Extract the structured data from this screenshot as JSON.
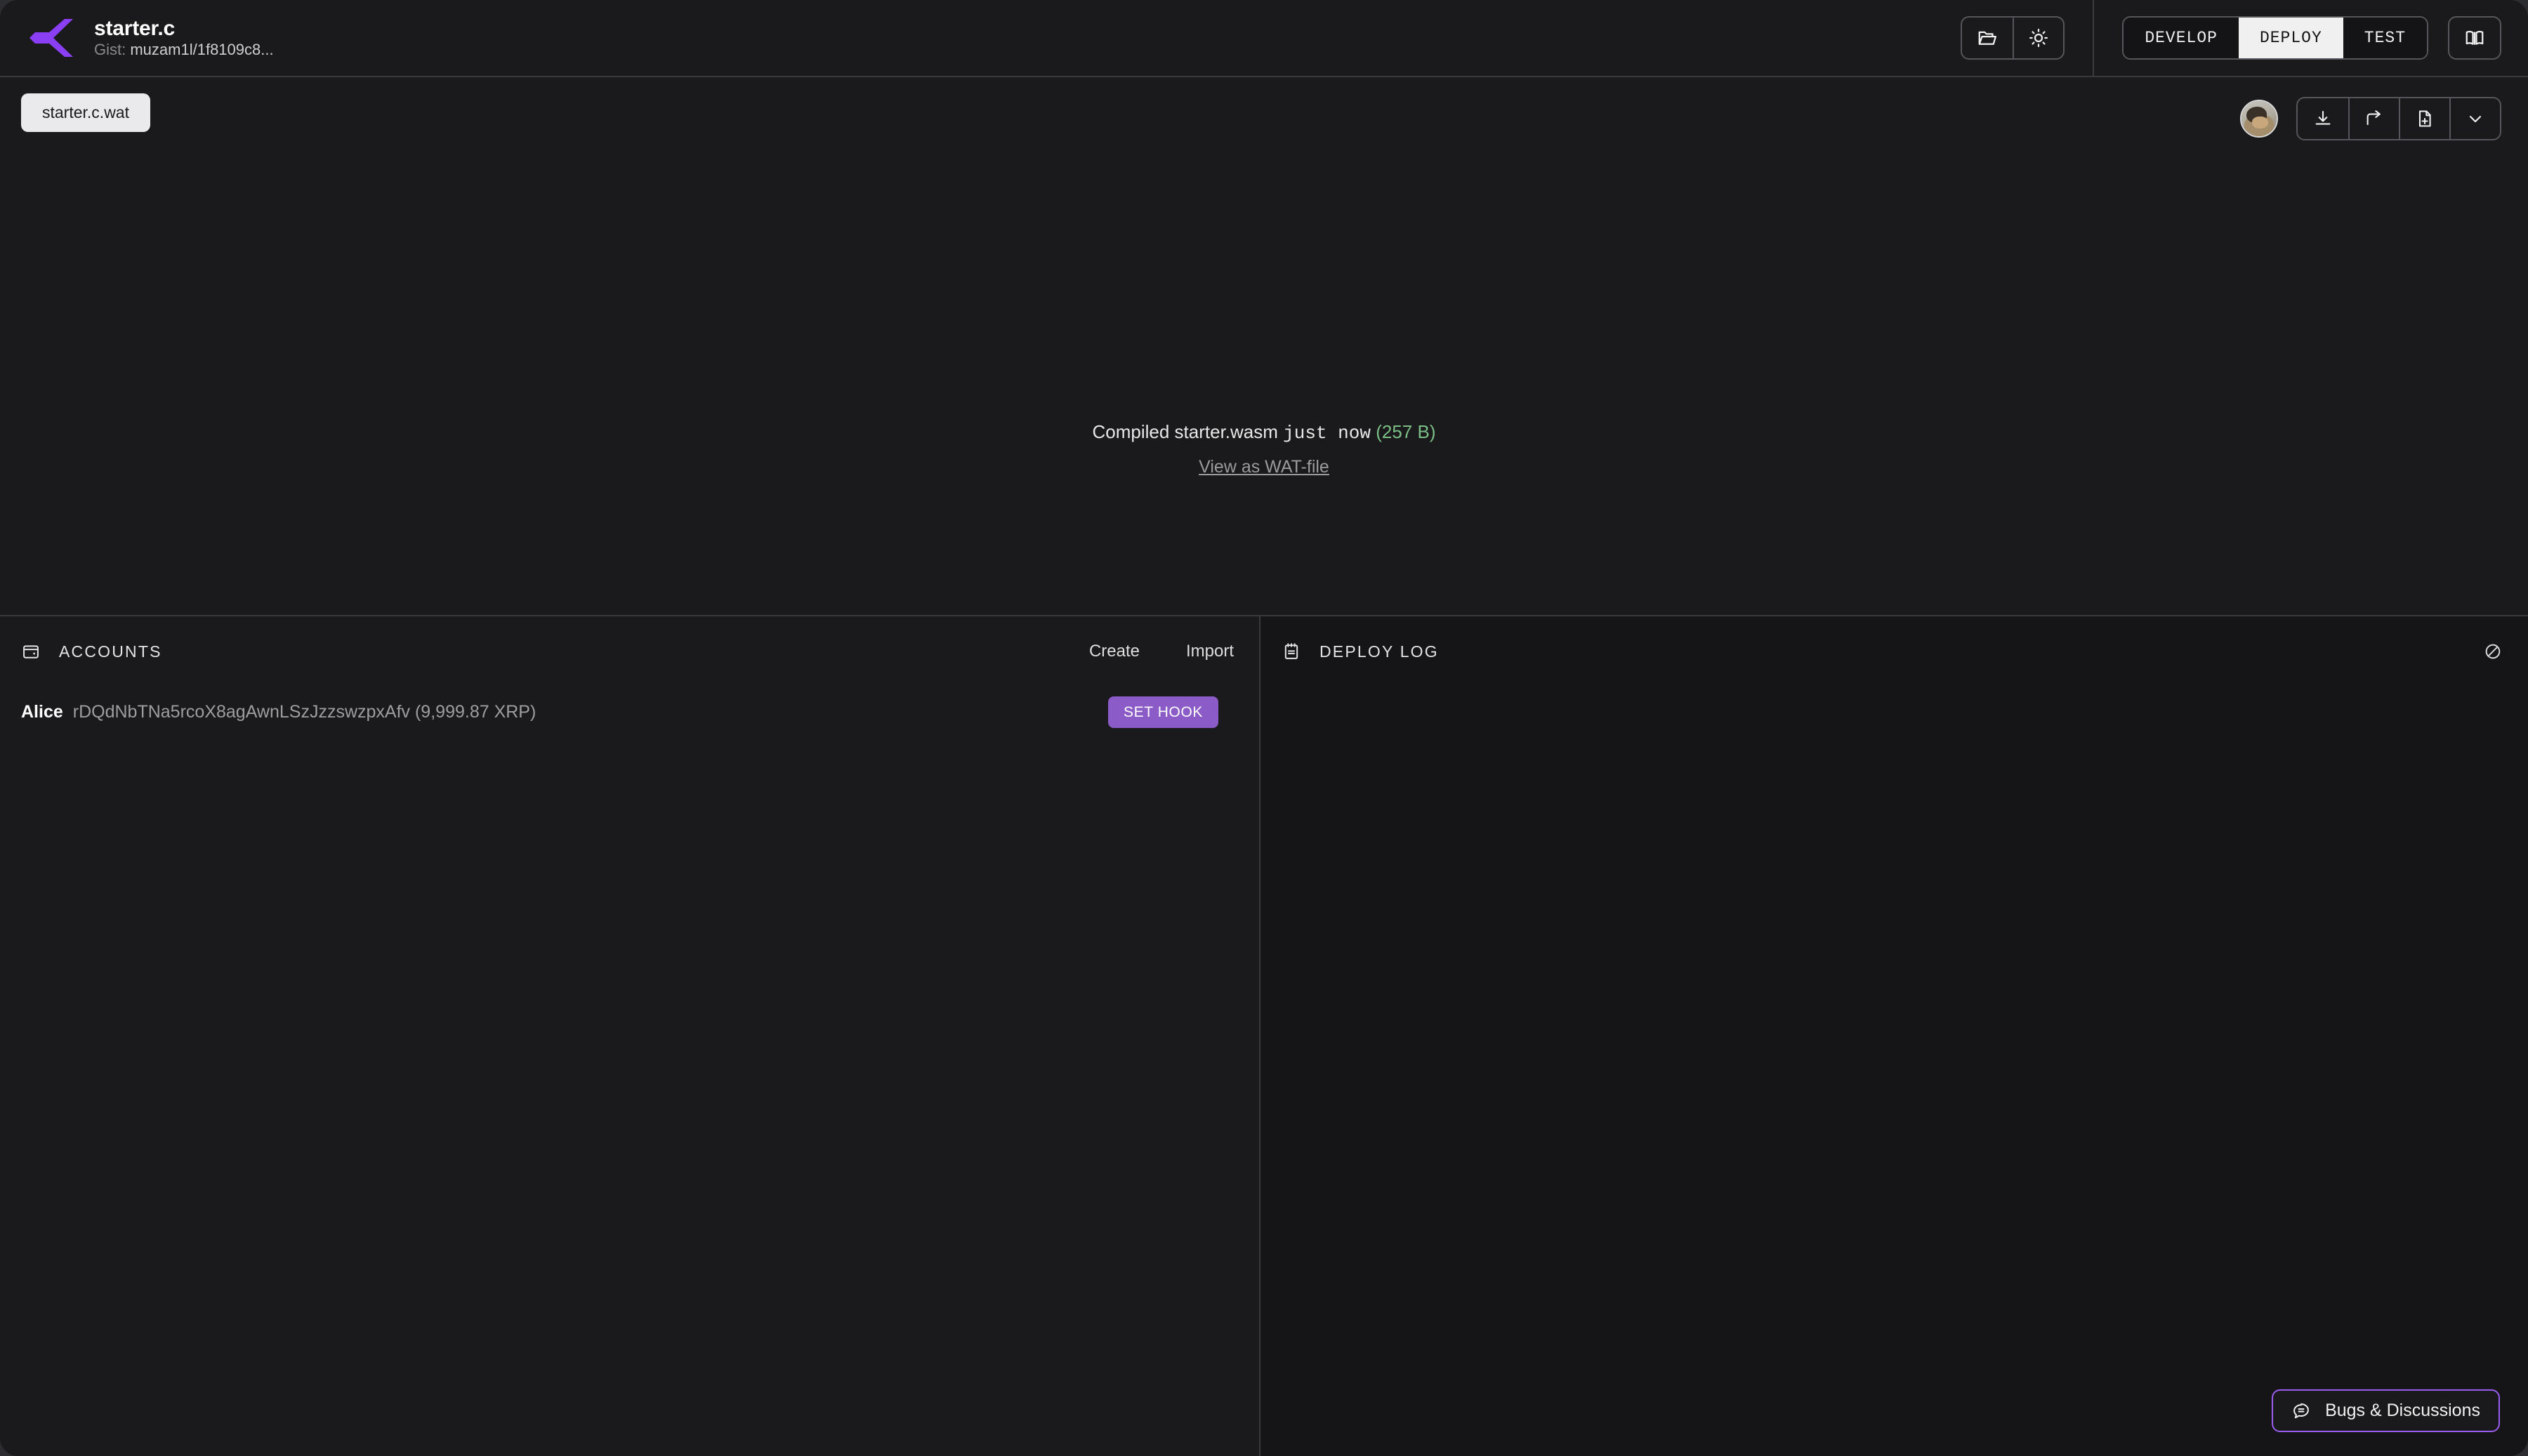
{
  "header": {
    "logo_icon": "hooks-builder-logo",
    "file_title": "starter.c",
    "gist_label": "Gist:",
    "gist_value": "muzam1l/1f8109c8...",
    "open_icon": "folder-open-icon",
    "theme_icon": "sun-icon",
    "docs_icon": "book-icon",
    "modes": [
      {
        "label": "DEVELOP",
        "active": false
      },
      {
        "label": "DEPLOY",
        "active": true
      },
      {
        "label": "TEST",
        "active": false
      }
    ]
  },
  "editor": {
    "tabs": [
      {
        "label": "starter.c.wat",
        "active": true
      }
    ],
    "avatar_icon": "user-avatar",
    "actions": [
      {
        "icon": "download-icon"
      },
      {
        "icon": "share-icon"
      },
      {
        "icon": "new-file-icon"
      },
      {
        "icon": "chevron-down-icon"
      }
    ],
    "compile": {
      "prefix": "Compiled starter.wasm",
      "time": "just now",
      "size": "(257 B)",
      "size_color": "#7bbf86",
      "link": "View as WAT-file"
    }
  },
  "accounts_panel": {
    "icon": "wallet-icon",
    "title": "ACCOUNTS",
    "create_label": "Create",
    "import_label": "Import",
    "rows": [
      {
        "name": "Alice",
        "address": "rDQdNbTNa5rcoX8agAwnLSzJzzswzpxAfv (9,999.87 XRP)",
        "action_label": "SET HOOK",
        "action_color": "#8b5cc7"
      }
    ]
  },
  "log_panel": {
    "icon": "notepad-icon",
    "title": "DEPLOY LOG",
    "clear_icon": "clear-ban-icon",
    "entries": []
  },
  "footer": {
    "bugs_icon": "chat-icon",
    "bugs_label": "Bugs & Discussions",
    "accent_color": "#9b5cf0"
  }
}
